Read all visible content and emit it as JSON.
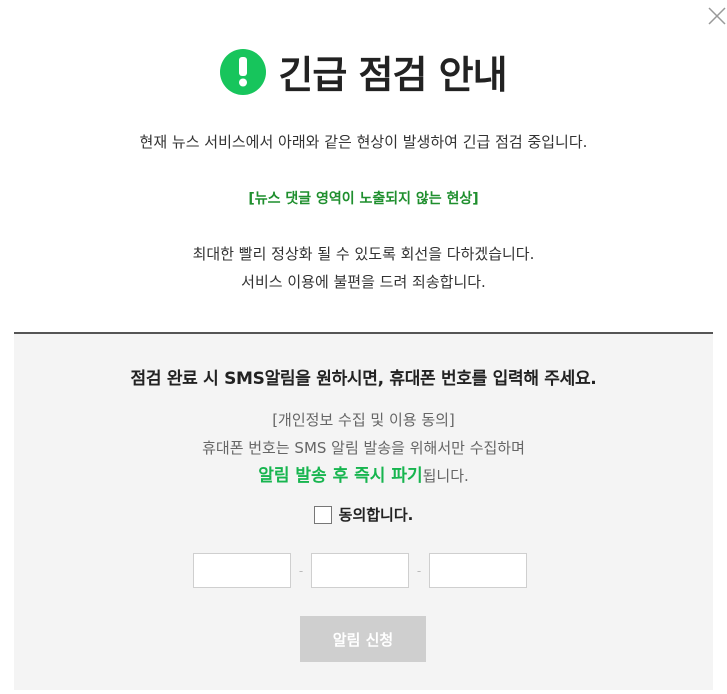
{
  "title": "긴급 점검 안내",
  "description": "현재 뉴스 서비스에서 아래와 같은 현상이 발생하여 긴급 점검 중입니다.",
  "issue": "[뉴스 댓글 영역이 노출되지 않는 현상]",
  "apology_lines": [
    "최대한 빨리 정상화 될 수 있도록 회선을 다하겠습니다.",
    "서비스 이용에 불편을 드려 죄송합니다."
  ],
  "sms": {
    "heading": "점검 완료 시 SMS알림을 원하시면, 휴대폰 번호를 입력해 주세요.",
    "privacy_title": "[개인정보 수집 및 이용 동의]",
    "privacy_line": "휴대폰 번호는 SMS 알림 발송을 위해서만 수집하며",
    "privacy_highlight": "알림 발송 후 즉시 파기",
    "privacy_suffix": "됩니다.",
    "agree_label": "동의합니다.",
    "phone_separator": "-",
    "phone_values": [
      "",
      "",
      ""
    ],
    "submit_label": "알림 신청"
  },
  "colors": {
    "accent_green": "#17c55c",
    "issue_green": "#1f8f2e",
    "disabled_button": "#cfcfcf"
  },
  "icons": {
    "alert": "exclamation-circle-icon",
    "close": "close-icon"
  }
}
